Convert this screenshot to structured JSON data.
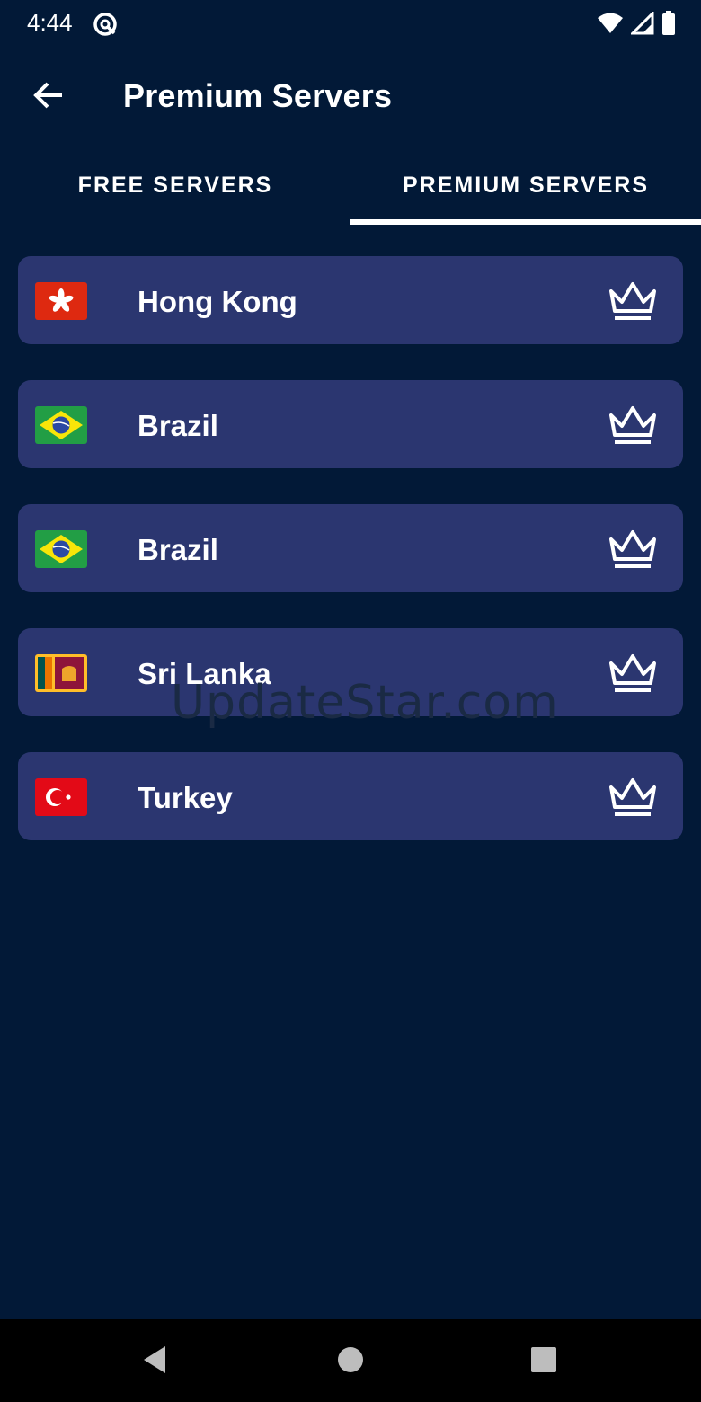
{
  "status_bar": {
    "time": "4:44",
    "icons": [
      "notification-icon",
      "wifi-icon",
      "signal-icon",
      "battery-icon"
    ]
  },
  "app_bar": {
    "title": "Premium Servers",
    "back_icon": "arrow-back-icon"
  },
  "tabs": [
    {
      "label": "FREE SERVERS",
      "selected": false
    },
    {
      "label": "PREMIUM SERVERS",
      "selected": true
    }
  ],
  "servers": [
    {
      "country": "Hong Kong",
      "flag": "hong-kong-flag",
      "badge": "crown-icon"
    },
    {
      "country": "Brazil",
      "flag": "brazil-flag",
      "badge": "crown-icon"
    },
    {
      "country": "Brazil",
      "flag": "brazil-flag",
      "badge": "crown-icon"
    },
    {
      "country": "Sri Lanka",
      "flag": "sri-lanka-flag",
      "badge": "crown-icon"
    },
    {
      "country": "Turkey",
      "flag": "turkey-flag",
      "badge": "crown-icon"
    }
  ],
  "watermark": "UpdateStar.com",
  "nav_bar": {
    "buttons": [
      "back-triangle-icon",
      "home-circle-icon",
      "recents-square-icon"
    ]
  },
  "colors": {
    "background": "#021937",
    "card": "#2b3670",
    "text": "#ffffff",
    "nav_bar": "#000000"
  }
}
